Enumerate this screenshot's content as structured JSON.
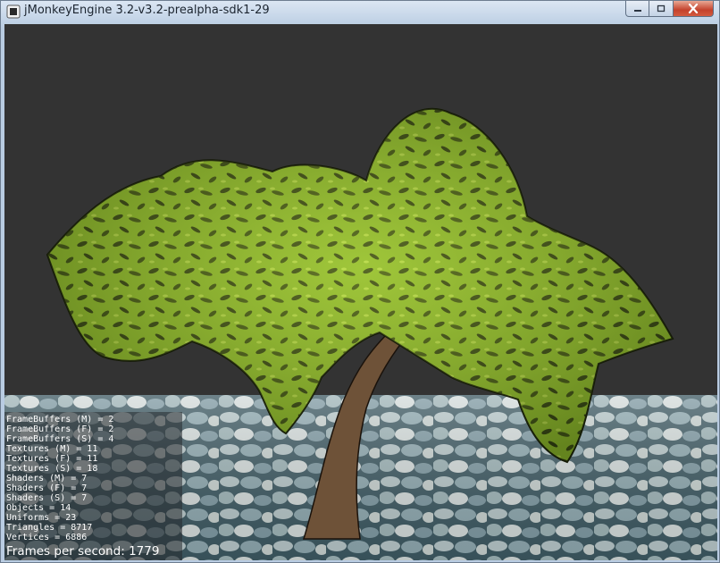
{
  "window": {
    "title": "jMonkeyEngine 3.2-v3.2-prealpha-sdk1-29",
    "controls": {
      "minimize": "minimize",
      "maximize": "maximize",
      "close": "close"
    }
  },
  "scene": {
    "background_color": "#333333",
    "foliage_color": "#8cb82a",
    "trunk_color": "#6e5238",
    "ground": "cobblestone"
  },
  "stats": {
    "lines": [
      "FrameBuffers (M) = 2",
      "FrameBuffers (F) = 2",
      "FrameBuffers (S) = 4",
      "Textures (M) = 11",
      "Textures (F) = 11",
      "Textures (S) = 18",
      "Shaders (M) = 7",
      "Shaders (F) = 7",
      "Shaders (S) = 7",
      "Objects = 14",
      "Uniforms = 23",
      "Triangles = 8717",
      "Vertices = 6886"
    ],
    "fps": "Frames per second: 1779"
  }
}
